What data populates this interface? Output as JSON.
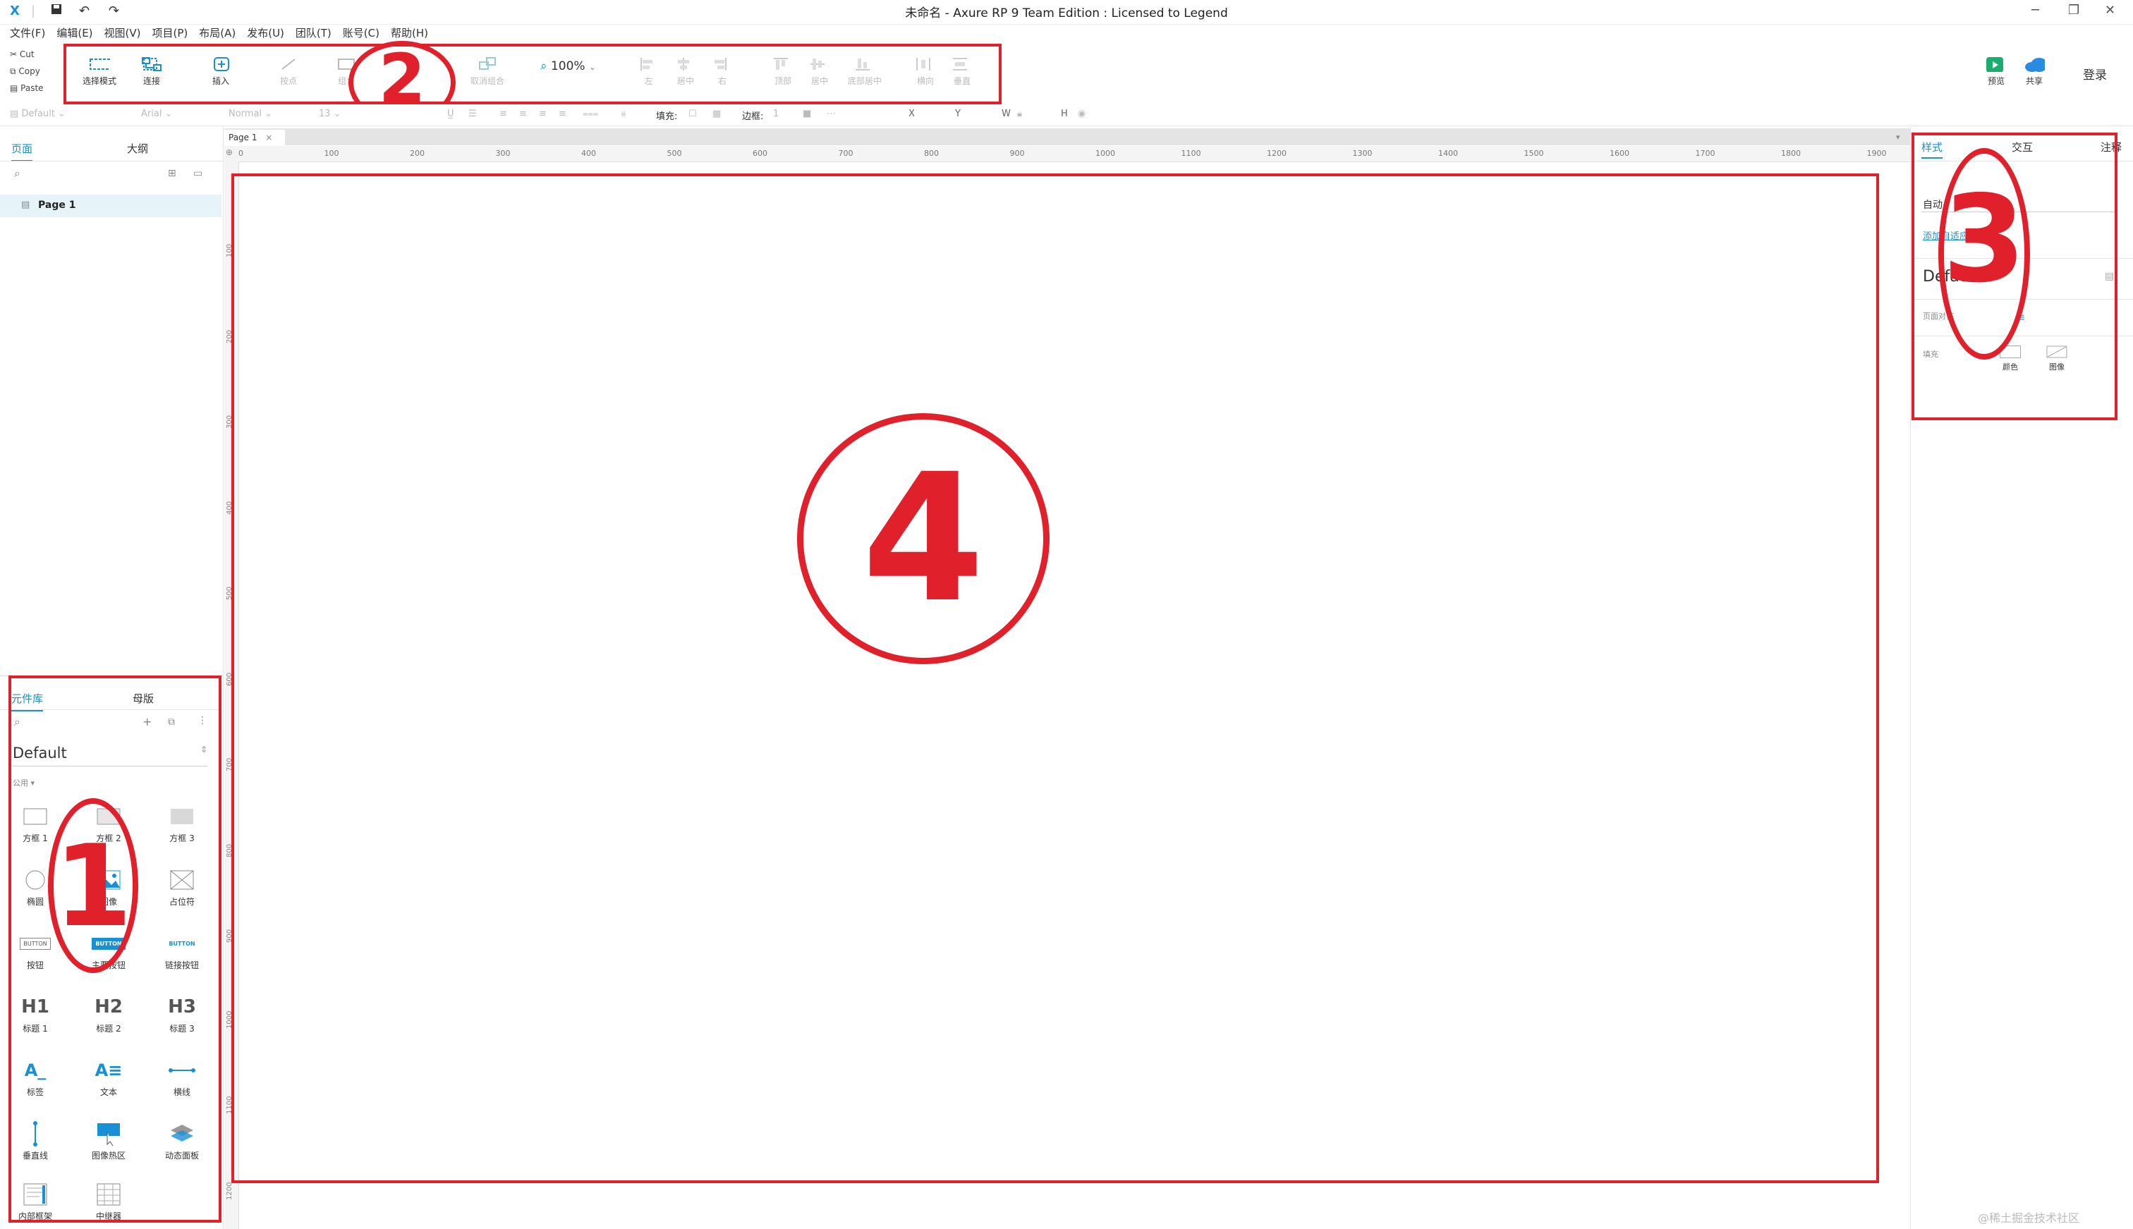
{
  "window": {
    "title": "未命名 - Axure RP 9 Team Edition : Licensed to Legend",
    "minimize": "─",
    "restore": "❐",
    "close": "✕"
  },
  "menu": [
    "文件(F)",
    "编辑(E)",
    "视图(V)",
    "项目(P)",
    "布局(A)",
    "发布(U)",
    "团队(T)",
    "账号(C)",
    "帮助(H)"
  ],
  "clipboard": {
    "cut": "Cut",
    "copy": "Copy",
    "paste": "Paste"
  },
  "toolbar": {
    "select_mode": "选择模式",
    "connect": "连接",
    "insert": "插入",
    "point": "按点",
    "group": "组合",
    "ungroup": "取消组合",
    "zoom": "100%",
    "left": "左",
    "center": "居中",
    "right": "右",
    "top": "顶部",
    "middle": "居中",
    "bottom": "底部居中",
    "horizontal": "横向",
    "vertical": "垂直",
    "preview": "预览",
    "share": "共享",
    "login": "登录"
  },
  "format_bar": {
    "style": "Default",
    "font": "Arial",
    "weight": "Normal",
    "size": "13",
    "fill_label": "填充:",
    "border_label": "边框:",
    "border_value": "1",
    "x_label": "X",
    "y_label": "Y",
    "w_label": "W",
    "h_label": "H"
  },
  "left_top": {
    "tab_pages": "页面",
    "tab_outline": "大纲",
    "page_item": "Page 1"
  },
  "library": {
    "tab_widgets": "元件库",
    "tab_masters": "母版",
    "library_name": "Default",
    "section": "公用 ▾",
    "widgets": [
      "方框 1",
      "方框 2",
      "方框 3",
      "椭圆",
      "图像",
      "占位符",
      "按钮",
      "主要按钮",
      "链接按钮",
      "标题 1",
      "标题 2",
      "标题 3",
      "标签",
      "文本",
      "横线",
      "垂直线",
      "图像热区",
      "动态面板",
      "内部框架",
      "中继器"
    ],
    "h1": "H1",
    "h2": "H2",
    "h3": "H3",
    "button_text": "BUTTON"
  },
  "canvas": {
    "page_tab": "Page 1",
    "ruler_top": [
      "0",
      "100",
      "200",
      "300",
      "400",
      "500",
      "600",
      "700",
      "800",
      "900",
      "1000",
      "1100",
      "1200",
      "1300",
      "1400",
      "1500",
      "1600",
      "1700",
      "1800",
      "1900"
    ],
    "ruler_left": [
      "100",
      "200",
      "300",
      "400",
      "500",
      "600",
      "700",
      "800",
      "900",
      "1000",
      "1100",
      "1200"
    ]
  },
  "right_panel": {
    "tab_style": "样式",
    "tab_interact": "交互",
    "tab_notes": "注释",
    "auto": "自动",
    "adaptive": "添加自适应视图",
    "default": "Default",
    "page_align": "页面对齐",
    "fill": "填充",
    "color": "颜色",
    "image": "图像"
  },
  "annotations": [
    "1",
    "2",
    "3",
    "4"
  ],
  "watermark": "@稀土掘金技术社区",
  "colors": {
    "accent": "#1890d5",
    "annotation": "#e0202a",
    "preview_green": "#1aad6e",
    "share_blue": "#2a8be0"
  }
}
